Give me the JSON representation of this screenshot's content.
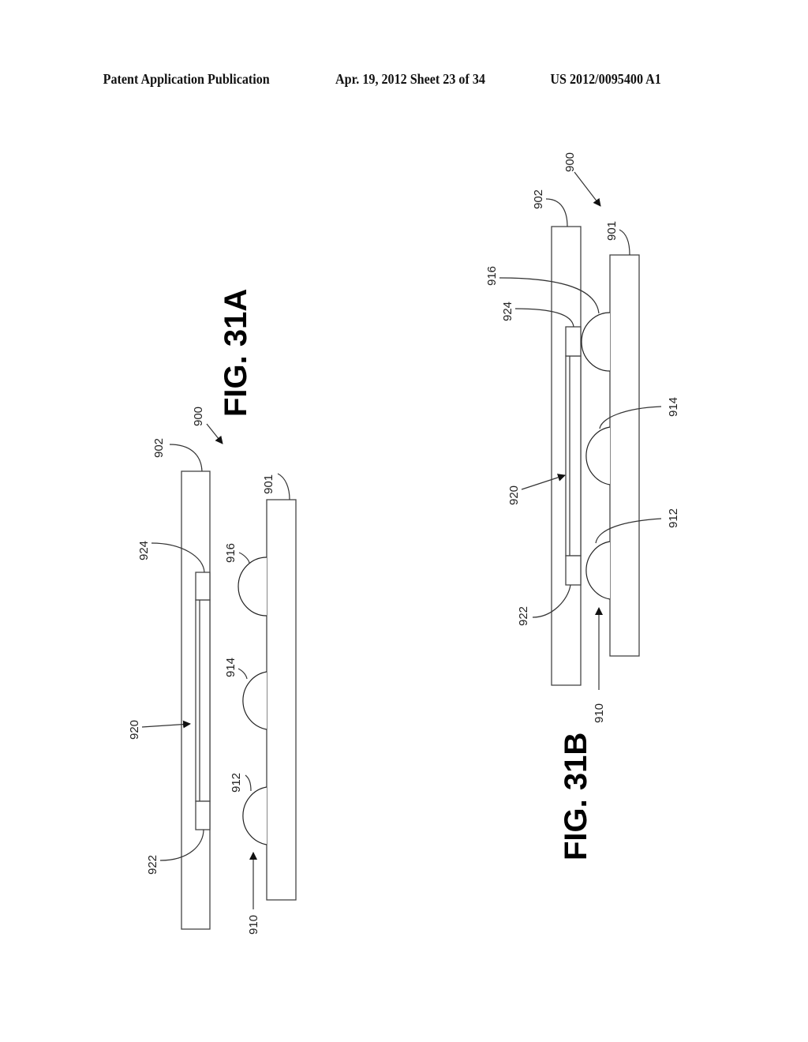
{
  "header": {
    "left": "Patent Application Publication",
    "middle": "Apr. 19, 2012  Sheet 23 of 34",
    "right": "US 2012/0095400 A1"
  },
  "figures": [
    {
      "id": "fig-31a",
      "label": "FIG. 31A",
      "refs": {
        "assembly": "900",
        "upper_substrate": "902",
        "lower_substrate": "901",
        "pad_top": "924",
        "pad_bottom": "922",
        "trace": "920",
        "bump_top": "916",
        "bump_middle": "914",
        "bump_bottom": "912",
        "bump_group": "910"
      }
    },
    {
      "id": "fig-31b",
      "label": "FIG. 31B",
      "refs": {
        "assembly": "900",
        "upper_substrate": "902",
        "lower_substrate": "901",
        "pad_top": "924",
        "pad_bottom": "922",
        "trace": "920",
        "bump_top": "916",
        "bump_middle": "914",
        "bump_bottom": "912",
        "bump_group": "910"
      }
    }
  ]
}
